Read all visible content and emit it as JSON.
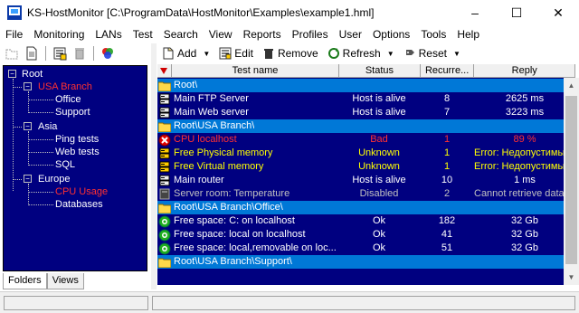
{
  "window": {
    "app_name": "KS-HostMonitor",
    "title": "KS-HostMonitor  [C:\\ProgramData\\HostMonitor\\Examples\\example1.hml]",
    "minimize": "–",
    "maximize": "☐",
    "close": "✕"
  },
  "menu": [
    "File",
    "Monitoring",
    "LANs",
    "Test",
    "Search",
    "View",
    "Reports",
    "Profiles",
    "User",
    "Options",
    "Tools",
    "Help"
  ],
  "tree": {
    "root": "Root",
    "usa": "USA Branch",
    "office": "Office",
    "support": "Support",
    "asia": "Asia",
    "ping": "Ping tests",
    "web": "Web tests",
    "sql": "SQL",
    "europe": "Europe",
    "cpu": "CPU Usage",
    "databases": "Databases"
  },
  "left_tabs": [
    "Folders",
    "Views"
  ],
  "toolbar": {
    "add": "Add",
    "edit": "Edit",
    "remove": "Remove",
    "refresh": "Refresh",
    "reset": "Reset"
  },
  "grid": {
    "headers": [
      "Test name",
      "Status",
      "Recurre...",
      "Reply"
    ],
    "rows": [
      {
        "type": "folder",
        "name": "Root\\"
      },
      {
        "type": "test",
        "icon": "server",
        "name": "Main FTP Server",
        "status": "Host is alive",
        "rec": "8",
        "reply": "2625 ms",
        "color": "#ffffff"
      },
      {
        "type": "test",
        "icon": "server",
        "name": "Main Web server",
        "status": "Host is alive",
        "rec": "7",
        "reply": "3223 ms",
        "color": "#ffffff"
      },
      {
        "type": "folder",
        "name": "Root\\USA Branch\\"
      },
      {
        "type": "test",
        "icon": "bad",
        "name": "CPU localhost",
        "status": "Bad",
        "rec": "1",
        "reply": "89 %",
        "color": "#ff3030"
      },
      {
        "type": "test",
        "icon": "unknown",
        "name": "Free Physical memory",
        "status": "Unknown",
        "rec": "1",
        "reply": "Error: Недопустимый...",
        "color": "#ffff00"
      },
      {
        "type": "test",
        "icon": "unknown",
        "name": "Free Virtual memory",
        "status": "Unknown",
        "rec": "1",
        "reply": "Error: Недопустимый...",
        "color": "#ffff00"
      },
      {
        "type": "test",
        "icon": "server",
        "name": "Main router",
        "status": "Host is alive",
        "rec": "10",
        "reply": "1 ms",
        "color": "#ffffff"
      },
      {
        "type": "test",
        "icon": "disabled",
        "name": "Server room: Temperature",
        "status": "Disabled",
        "rec": "2",
        "reply": "Cannot retrieve data f...",
        "color": "#c0c0c0"
      },
      {
        "type": "folder",
        "name": "Root\\USA Branch\\Office\\"
      },
      {
        "type": "test",
        "icon": "ok",
        "name": "Free space: C: on localhost",
        "status": "Ok",
        "rec": "182",
        "reply": "32 Gb",
        "color": "#ffffff"
      },
      {
        "type": "test",
        "icon": "ok",
        "name": "Free space: local on localhost",
        "status": "Ok",
        "rec": "41",
        "reply": "32 Gb",
        "color": "#ffffff"
      },
      {
        "type": "test",
        "icon": "ok",
        "name": "Free space: local,removable on loc...",
        "status": "Ok",
        "rec": "51",
        "reply": "32 Gb",
        "color": "#ffffff"
      },
      {
        "type": "folder",
        "name": "Root\\USA Branch\\Support\\"
      }
    ]
  },
  "colors": {
    "tree_bg": "#000080",
    "grid_bg": "#000080",
    "folder_row": "#0078d7",
    "alive": "#ffffff",
    "bad": "#ff3030",
    "unknown": "#ffff00",
    "disabled": "#c0c0c0"
  }
}
